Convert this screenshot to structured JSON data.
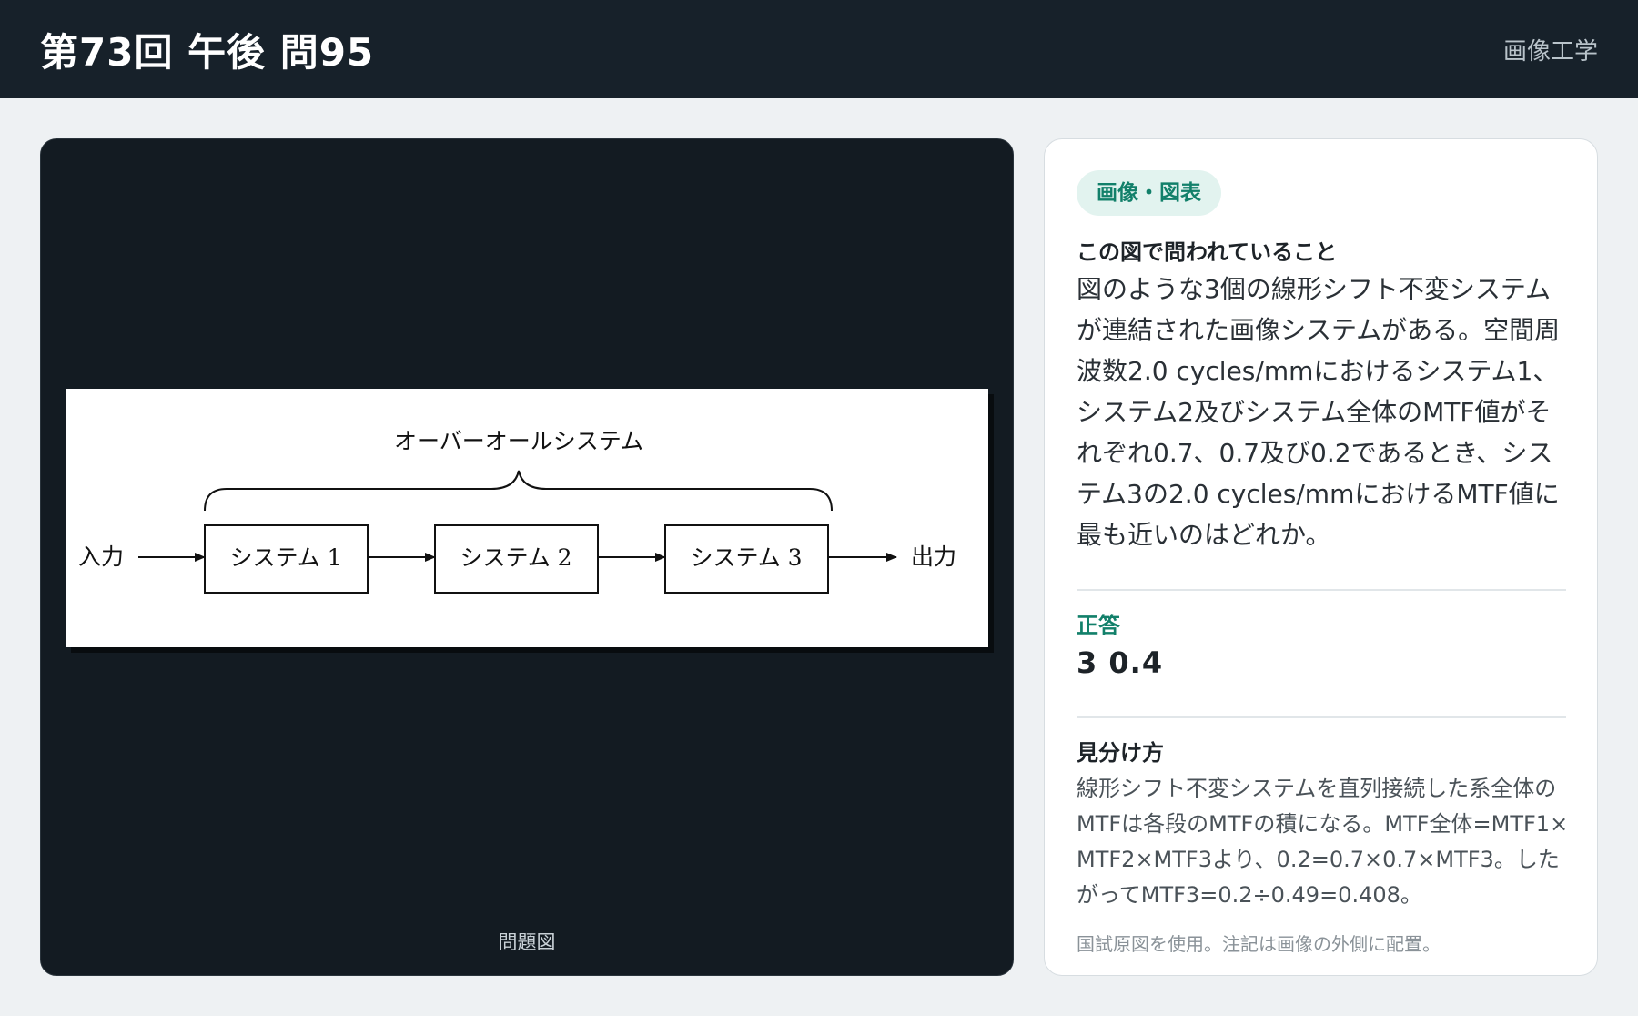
{
  "header": {
    "title": "第73回 午後 問95",
    "subject": "画像工学"
  },
  "figure": {
    "caption": "問題図",
    "diagram": {
      "overall_label": "オーバーオールシステム",
      "input_label": "入力",
      "output_label": "出力",
      "blocks": [
        "システム 1",
        "システム 2",
        "システム 3"
      ]
    }
  },
  "info": {
    "tag": "画像・図表",
    "question_heading": "この図で問われていること",
    "question_text": "図のような3個の線形シフト不変システムが連結された画像システムがある。空間周波数2.0 cycles/mmにおけるシステム1、システム2及びシステム全体のMTF値がそれぞれ0.7、0.7及び0.2であるとき、システム3の2.0 cycles/mmにおけるMTF値に最も近いのはどれか。",
    "answer_heading": "正答",
    "answer_value": "3 0.4",
    "hint_heading": "見分け方",
    "hint_text": "線形シフト不変システムを直列接続した系全体のMTFは各段のMTFの積になる。MTF全体=MTF1×MTF2×MTF3より、0.2=0.7×0.7×MTF3。したがってMTF3=0.2÷0.49=0.408。",
    "note": "国試原図を使用。注記は画像の外側に配置。"
  }
}
